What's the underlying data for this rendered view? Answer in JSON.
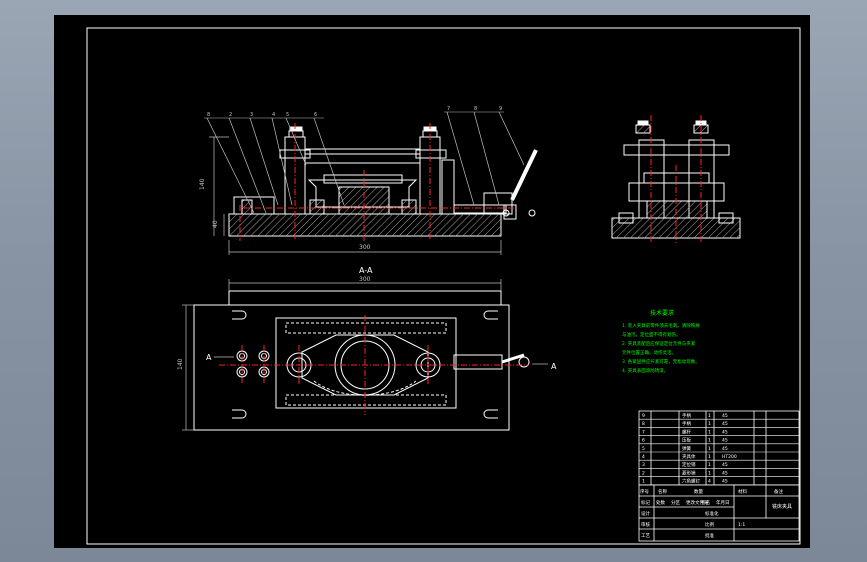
{
  "section_label": "A-A",
  "view_arrow_label": "A",
  "dimensions": {
    "front_width": "300",
    "plan_width": "300",
    "front_height": "140",
    "front_base": "40",
    "plan_depth": "140"
  },
  "tech_requirements": {
    "title": "技术要求",
    "lines": [
      "1. 装入夹具前零件须去毛刺，清除铁屑",
      "   与油污。定位面不得有划伤。",
      "2. 夹具装配后应保证定位元件与夹紧",
      "   元件位置正确，动作灵活。",
      "3. 各紧固件应拧紧可靠，无松动现象。",
      "4. 夹具表面涂防锈漆。"
    ]
  },
  "parts_table": {
    "rows": [
      {
        "no": "9",
        "name": "手柄",
        "qty": "1",
        "material": "45"
      },
      {
        "no": "8",
        "name": "手柄",
        "qty": "1",
        "material": "45"
      },
      {
        "no": "7",
        "name": "螺杆",
        "qty": "1",
        "material": "45"
      },
      {
        "no": "6",
        "name": "压板",
        "qty": "1",
        "material": "45"
      },
      {
        "no": "5",
        "name": "弹簧",
        "qty": "1",
        "material": "45"
      },
      {
        "no": "4",
        "name": "夹具体",
        "qty": "1",
        "material": "HT200"
      },
      {
        "no": "3",
        "name": "定位销",
        "qty": "1",
        "material": "45"
      },
      {
        "no": "2",
        "name": "菱形销",
        "qty": "1",
        "material": "45"
      },
      {
        "no": "1",
        "name": "六角螺钉",
        "qty": "4",
        "material": "45"
      }
    ],
    "header": {
      "no": "序号",
      "name": "名称",
      "qty": "数量",
      "material": "材料",
      "remark": "备注"
    },
    "title_block": {
      "drawing_title": "铣床夹具",
      "row1": [
        "标记",
        "处数",
        "分区",
        "更改文件号",
        "签名",
        "年月日"
      ],
      "row2": [
        "设计",
        "",
        "标准化"
      ],
      "row3": [
        "审核",
        "",
        "比例"
      ],
      "row4": [
        "工艺",
        "",
        "批准"
      ],
      "scale": "1:1"
    }
  },
  "balloons": [
    "8",
    "2",
    "3",
    "4",
    "5",
    "6",
    "7",
    "8",
    "9"
  ],
  "colors": {
    "background": "#000000",
    "outline": "#ffffff",
    "centerline": "#ff2020",
    "dimension": "#c0c0c0",
    "note_text": "#00ff00",
    "section_hatch": "#b0b0b0",
    "part_accent": "#ffff00"
  }
}
